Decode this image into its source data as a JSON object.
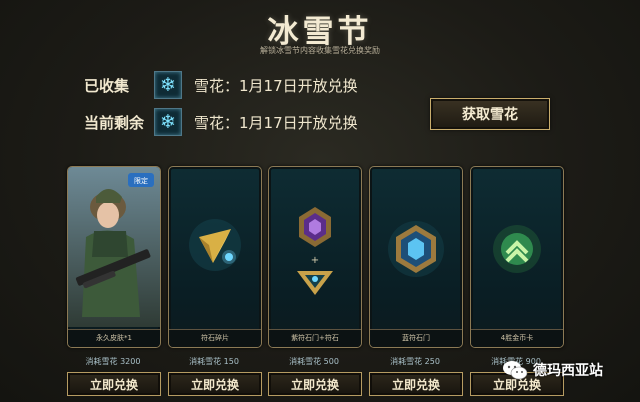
{
  "header": {
    "title": "冰雪节",
    "subtitle": "解锁冰雪节内容收集雪花兑换奖励"
  },
  "status": {
    "collected_label": "已收集",
    "collected_text": "雪花：1月17日开放兑换",
    "remaining_label": "当前剩余",
    "remaining_text": "雪花：1月17日开放兑换",
    "icon": "snowflake-icon"
  },
  "get_button_label": "获取雪花",
  "cards": [
    {
      "name": "永久皮肤*1",
      "cost": "消耗雪花 3200",
      "button": "立即兑换",
      "icon": "skin-portrait"
    },
    {
      "name": "符石碎片",
      "cost": "消耗雪花 150",
      "button": "立即兑换",
      "icon": "rune-shard-icon"
    },
    {
      "name": "紫符石门+符石",
      "cost": "消耗雪花 500",
      "button": "立即兑换",
      "icon": "purple-rune-icon"
    },
    {
      "name": "蓝符石门",
      "cost": "消耗雪花 250",
      "button": "立即兑换",
      "icon": "blue-rune-icon"
    },
    {
      "name": "4胜金币卡",
      "cost": "消耗雪花 900",
      "button": "立即兑换",
      "icon": "gold-card-icon"
    }
  ],
  "watermark": "德玛西亚站",
  "colors": {
    "accent_gold": "#c9ad6c",
    "snowflake_cyan": "#7fe3ff",
    "card_teal": "#0e2c33"
  }
}
